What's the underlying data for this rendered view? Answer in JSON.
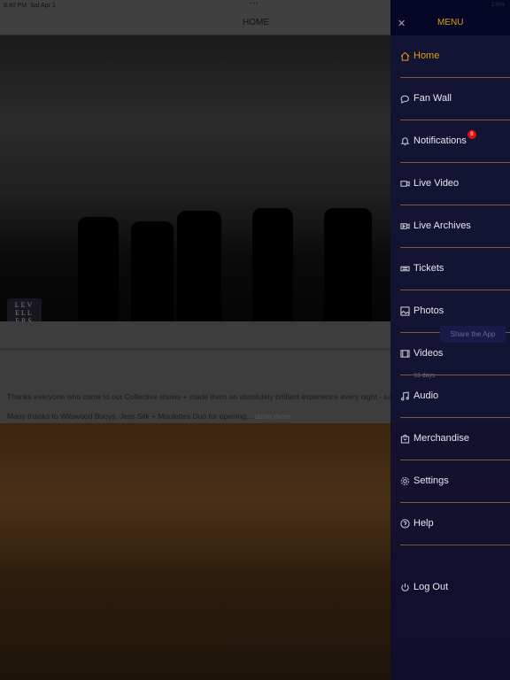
{
  "status": {
    "time": "8:40 PM",
    "date": "Sat Apr 1",
    "battery": "100%"
  },
  "header": {
    "title": "HOME"
  },
  "logo_text": "LEV ELL ERS",
  "share_button": "Share the App",
  "post": {
    "age": "13 days",
    "line1": "Thanks everyone who came to our Collective shows + made them an absolutely brilliant experience every night - salute u!",
    "line2": "Many thanks to Wilswood Buoys, Jess Silk + Moulettes Duo for opening....",
    "show_more": "show more"
  },
  "menu": {
    "title": "MENU",
    "close_icon": "close-icon",
    "accent": "#e0a010",
    "items": [
      {
        "label": "Home",
        "icon": "home-icon",
        "active": true
      },
      {
        "label": "Fan Wall",
        "icon": "chat-icon"
      },
      {
        "label": "Notifications",
        "icon": "bell-icon",
        "badge": "8"
      },
      {
        "label": "Live Video",
        "icon": "video-camera-icon"
      },
      {
        "label": "Live Archives",
        "icon": "archive-video-icon"
      },
      {
        "label": "Tickets",
        "icon": "ticket-icon"
      },
      {
        "label": "Photos",
        "icon": "photo-icon"
      },
      {
        "label": "Videos",
        "icon": "film-icon"
      },
      {
        "label": "Audio",
        "icon": "music-note-icon"
      },
      {
        "label": "Merchandise",
        "icon": "shopping-bag-icon"
      },
      {
        "label": "Settings",
        "icon": "gear-icon"
      },
      {
        "label": "Help",
        "icon": "help-icon"
      },
      {
        "label": "Log Out",
        "icon": "power-icon"
      }
    ]
  }
}
